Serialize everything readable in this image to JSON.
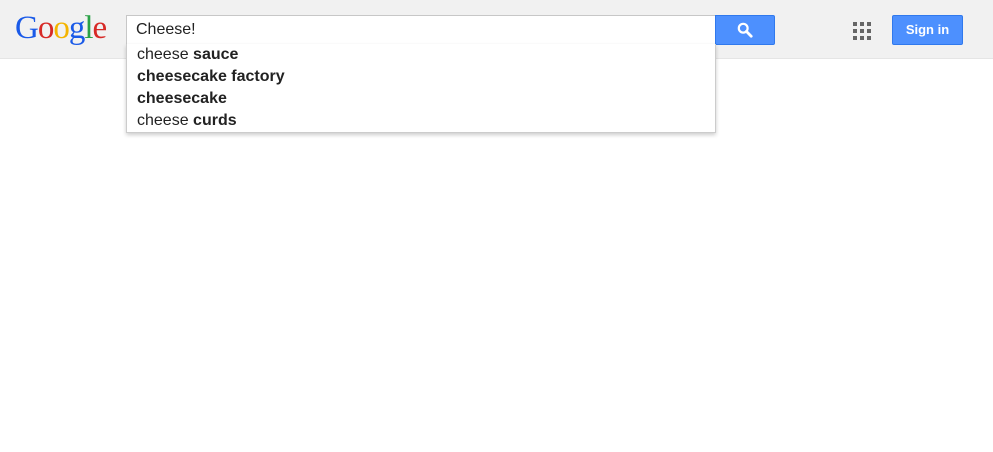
{
  "header": {
    "logo": {
      "letters": [
        {
          "char": "G",
          "color": "#1a5ae8"
        },
        {
          "char": "o",
          "color": "#d72a27"
        },
        {
          "char": "o",
          "color": "#f4b400"
        },
        {
          "char": "g",
          "color": "#1a5ae8"
        },
        {
          "char": "l",
          "color": "#2aa146"
        },
        {
          "char": "e",
          "color": "#d72a27"
        }
      ]
    },
    "search": {
      "value": "Cheese!",
      "button_icon": "search-icon"
    },
    "apps_icon": "apps-grid-icon",
    "signin_label": "Sign in"
  },
  "suggestions": [
    {
      "prefix": "cheese ",
      "completion": "sauce"
    },
    {
      "prefix": "",
      "completion": "cheesecake factory"
    },
    {
      "prefix": "",
      "completion": "cheesecake"
    },
    {
      "prefix": "cheese ",
      "completion": "curds"
    }
  ],
  "colors": {
    "accent": "#4d90fe",
    "topbar_bg": "#f1f1f1"
  }
}
